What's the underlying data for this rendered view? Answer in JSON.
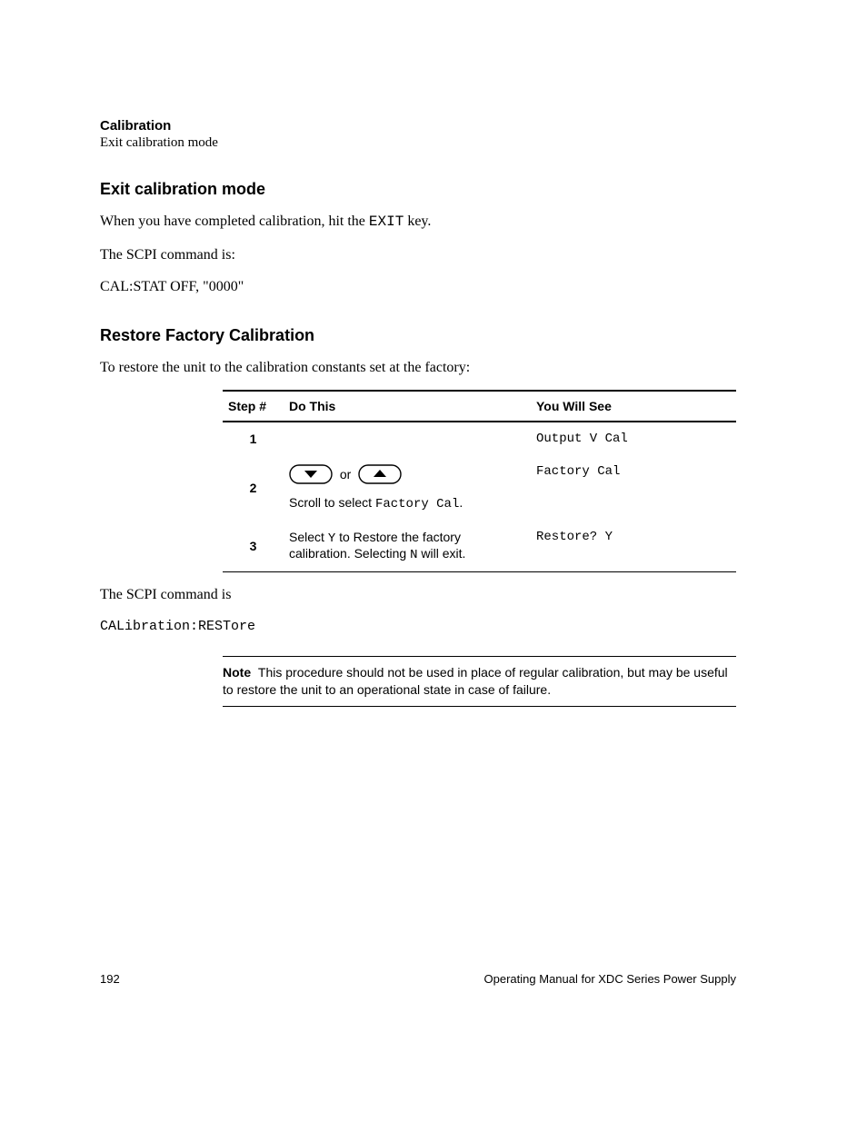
{
  "runhead": {
    "title": "Calibration",
    "subtitle": "Exit calibration mode"
  },
  "section_exit": {
    "heading": "Exit calibration mode",
    "p1_pre": "When you have completed calibration, hit the ",
    "p1_code": "EXIT",
    "p1_post": " key.",
    "p2": "The SCPI command is:",
    "p3": "CAL:STAT OFF, \"0000\""
  },
  "section_restore": {
    "heading": "Restore Factory Calibration",
    "intro": "To restore the unit to the calibration constants set at the factory:"
  },
  "table": {
    "col_step": "Step #",
    "col_do": "Do This",
    "col_see": "You Will See",
    "row1": {
      "num": "1",
      "do": "",
      "see": "Output V Cal"
    },
    "row2": {
      "num": "2",
      "or_word": "or",
      "scroll_pre": "Scroll to select ",
      "scroll_code": "Factory Cal",
      "scroll_post": ".",
      "see": "Factory Cal"
    },
    "row3": {
      "num": "3",
      "do_pre": "Select ",
      "do_y": "Y",
      "do_mid": " to Restore the factory calibration. Selecting ",
      "do_n": "N",
      "do_post": " will exit.",
      "see": "Restore? Y"
    }
  },
  "post_table": {
    "p1": "The SCPI command is",
    "p2": "CALibration:RESTore"
  },
  "note": {
    "label": "Note",
    "text": "This procedure should not be used in place of regular calibration, but may be useful to restore the unit to an operational state in case of failure."
  },
  "footer": {
    "page": "192",
    "text": "Operating Manual for XDC Series Power Supply"
  }
}
